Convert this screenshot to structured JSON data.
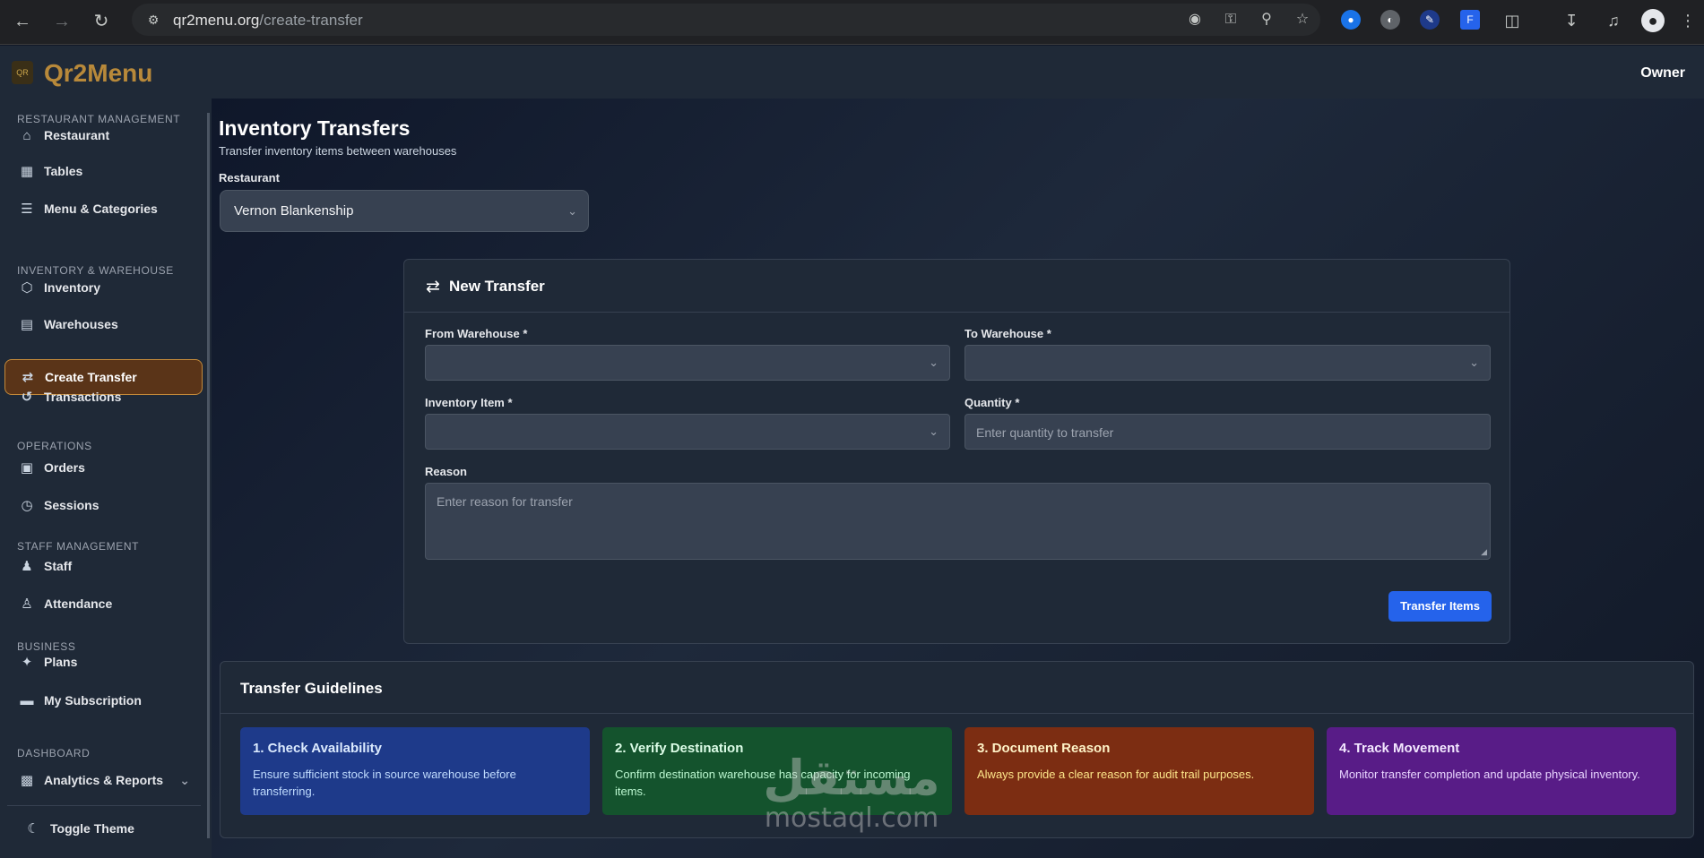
{
  "browser": {
    "url_host": "qr2menu.org",
    "url_path": "/create-transfer"
  },
  "app": {
    "brand": "Qr2Menu",
    "logo_text": "QR",
    "user_role": "Owner"
  },
  "sidebar": {
    "sections": {
      "restaurant": "RESTAURANT MANAGEMENT",
      "inventory": "INVENTORY & WAREHOUSE",
      "operations": "OPERATIONS",
      "staff": "STAFF MANAGEMENT",
      "business": "BUSINESS",
      "dashboard": "DASHBOARD"
    },
    "items": {
      "restaurant": "Restaurant",
      "tables": "Tables",
      "menu": "Menu & Categories",
      "inventory": "Inventory",
      "warehouses": "Warehouses",
      "create_transfer": "Create Transfer",
      "transactions": "Transactions",
      "orders": "Orders",
      "sessions": "Sessions",
      "staff": "Staff",
      "attendance": "Attendance",
      "plans": "Plans",
      "subscription": "My Subscription",
      "analytics": "Analytics & Reports"
    },
    "toggle_theme": "Toggle Theme",
    "active_item": "Create Transfer"
  },
  "page": {
    "title": "Inventory Transfers",
    "subtitle": "Transfer inventory items between warehouses",
    "restaurant_label": "Restaurant",
    "restaurant_value": "Vernon Blankenship"
  },
  "form": {
    "title": "New Transfer",
    "from_label": "From Warehouse *",
    "from_value": "",
    "to_label": "To Warehouse *",
    "to_value": "",
    "item_label": "Inventory Item *",
    "item_value": "",
    "qty_label": "Quantity *",
    "qty_placeholder": "Enter quantity to transfer",
    "reason_label": "Reason",
    "reason_placeholder": "Enter reason for transfer",
    "submit": "Transfer Items"
  },
  "guidelines": {
    "title": "Transfer Guidelines",
    "items": [
      {
        "title": "1. Check Availability",
        "desc": "Ensure sufficient stock in source warehouse before transferring.",
        "color": "#1e3a8a"
      },
      {
        "title": "2. Verify Destination",
        "desc": "Confirm destination warehouse has capacity for incoming items.",
        "color": "#14532d"
      },
      {
        "title": "3. Document Reason",
        "desc": "Always provide a clear reason for audit trail purposes.",
        "color": "#7c2d12"
      },
      {
        "title": "4. Track Movement",
        "desc": "Monitor transfer completion and update physical inventory.",
        "color": "#581c87"
      }
    ]
  },
  "watermark": {
    "arabic": "مستقل",
    "latin": "mostaql.com"
  },
  "colors": {
    "accent": "#2563eb",
    "brand": "#b8893a",
    "active_bg": "#5a3418"
  }
}
